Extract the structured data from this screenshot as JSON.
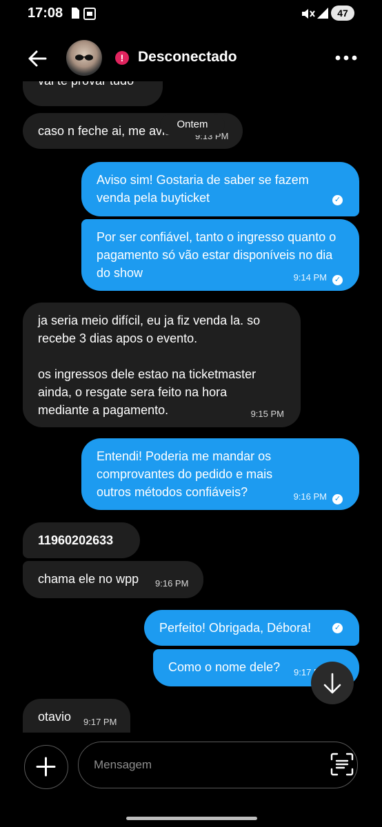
{
  "status_bar": {
    "time": "17:08",
    "battery": "47"
  },
  "header": {
    "contact_status": "Desconectado",
    "status_dot": "!"
  },
  "chat": {
    "day_separator": "Ontem",
    "messages": [
      {
        "dir": "in",
        "text": "vai te provar tudo"
      },
      {
        "dir": "in",
        "text": "caso n feche ai, me avise",
        "time": "9:13 PM"
      },
      {
        "dir": "out",
        "text": "Aviso sim! Gostaria de saber se fazem venda pela buyticket"
      },
      {
        "dir": "out",
        "text": "Por ser confiável, tanto o ingresso quanto o pagamento só vão estar disponíveis no dia do show",
        "time": "9:14 PM"
      },
      {
        "dir": "in",
        "text_p1": "ja seria meio difícil, eu ja fiz venda la. so recebe 3 dias apos o evento.",
        "text_p2": "os ingressos dele estao na ticketmaster ainda, o resgate sera feito na hora mediante a pagamento.",
        "time": "9:15 PM"
      },
      {
        "dir": "out",
        "text": "Entendi! Poderia me mandar os comprovantes do pedido e mais outros métodos confiáveis?",
        "time": "9:16 PM"
      },
      {
        "dir": "in",
        "text": "11960202633"
      },
      {
        "dir": "in",
        "text": "chama ele no wpp",
        "time": "9:16 PM"
      },
      {
        "dir": "out",
        "text": "Perfeito! Obrigada, Débora!"
      },
      {
        "dir": "out",
        "text": "Como o nome dele?",
        "time": "9:17 PM"
      },
      {
        "dir": "in",
        "text": "otavio",
        "time": "9:17 PM"
      }
    ]
  },
  "composer": {
    "placeholder": "Mensagem"
  },
  "icons": {
    "back": "arrow-left-icon",
    "more": "more-horizontal-icon",
    "status": "alert-icon",
    "scroll": "arrow-down-icon",
    "add": "plus-icon",
    "scan": "scan-text-icon",
    "read": "check-circle-icon"
  },
  "colors": {
    "background": "#000000",
    "outgoing_bubble": "#1d9bf0",
    "incoming_bubble": "#1f1f1f",
    "status_alert": "#e0245e"
  }
}
